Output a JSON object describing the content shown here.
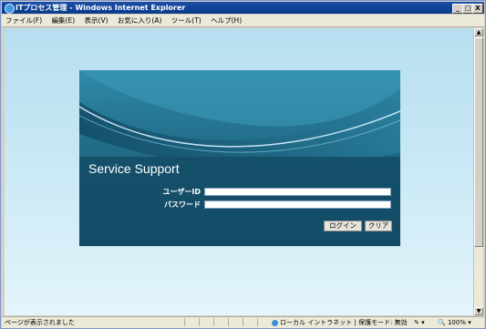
{
  "window": {
    "title": "ITプロセス管理 - Windows Internet Explorer",
    "minimize": "_",
    "maximize": "□",
    "close": "X"
  },
  "menu": {
    "items": [
      "ファイル(F)",
      "編集(E)",
      "表示(V)",
      "お気に入り(A)",
      "ツール(T)",
      "ヘルプ(H)"
    ]
  },
  "login": {
    "title": "Service Support",
    "user_label": "ユーザーID",
    "password_label": "パスワード",
    "user_value": "",
    "password_value": "",
    "login_button": "ログイン",
    "clear_button": "クリア"
  },
  "status": {
    "text": "ページが表示されました",
    "zone": "ローカル イントラネット | 保護モード: 無効",
    "zoom": "100%",
    "pencil": "✎ ▾"
  },
  "colors": {
    "panel": "#16506a",
    "content_bg": "#b6def0"
  }
}
